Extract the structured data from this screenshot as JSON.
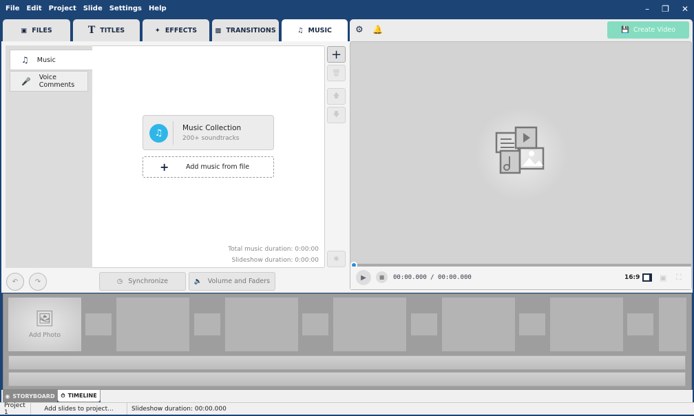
{
  "menu": [
    "File",
    "Edit",
    "Project",
    "Slide",
    "Settings",
    "Help"
  ],
  "tabs": [
    {
      "label": "FILES",
      "icon": "add-media-icon"
    },
    {
      "label": "TITLES",
      "icon": "text-icon"
    },
    {
      "label": "EFFECTS",
      "icon": "star-wand-icon"
    },
    {
      "label": "TRANSITIONS",
      "icon": "transition-icon"
    },
    {
      "label": "MUSIC",
      "icon": "music-note-icon",
      "active": true
    }
  ],
  "toolbar": {
    "create_video": "Create Video"
  },
  "music_panel": {
    "side_items": [
      {
        "label": "Music",
        "icon": "music-note-icon"
      },
      {
        "label": "Voice Comments",
        "icon": "microphone-icon"
      }
    ],
    "collection_title": "Music Collection",
    "collection_sub": "200+ soundtracks",
    "add_file": "Add music from file",
    "total_duration": "Total music duration: 0:00:00",
    "slideshow_duration": "Slideshow duration: 0:00:00"
  },
  "actions": {
    "synchronize": "Synchronize",
    "volume": "Volume and Faders"
  },
  "player": {
    "time": "00:00.000 / 00:00.000",
    "aspect": "16:9",
    "progress": 0
  },
  "timeline": {
    "add_photo": "Add Photo"
  },
  "bottom_tabs": {
    "storyboard": "STORYBOARD",
    "timeline": "TIMELINE"
  },
  "status": {
    "project": "Project 1",
    "hint": "Add slides to project...",
    "duration": "Slideshow duration: 00:00.000"
  },
  "colors": {
    "titlebar": "#1c4475",
    "accent": "#2fb6e8",
    "create_video": "#86dcc0"
  }
}
